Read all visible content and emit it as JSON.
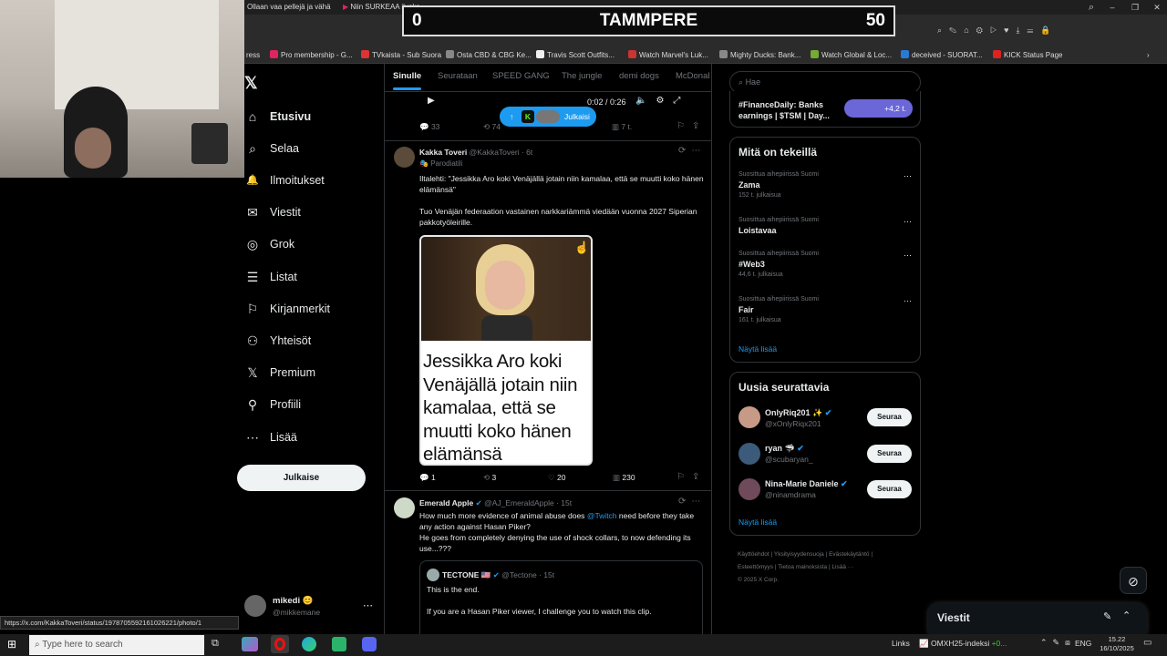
{
  "browser": {
    "tabs": [
      {
        "label": "Ollaan vaa pellejä ja vähä"
      },
      {
        "label": "Niin SURKEAA ilveks..."
      }
    ],
    "bookmarks": [
      {
        "label": "ress",
        "color": "#555555"
      },
      {
        "label": "Pro membership - G...",
        "color": "#e0245e"
      },
      {
        "label": "TVkaista - Sub Suora",
        "color": "#d33"
      },
      {
        "label": "Osta CBD & CBG Ke...",
        "color": "#888"
      },
      {
        "label": "Travis Scott Outfits...",
        "color": "#eee"
      },
      {
        "label": "Watch Marvel's Luk...",
        "color": "#c33"
      },
      {
        "label": "Mighty Ducks: Bank...",
        "color": "#888"
      },
      {
        "label": "Watch Global & Loc...",
        "color": "#7a3"
      },
      {
        "label": "deceived - SUORAT...",
        "color": "#2a7ad5"
      },
      {
        "label": "KICK Status Page",
        "color": "#d22"
      }
    ]
  },
  "overlay": {
    "left_score": "0",
    "team": "TAMMPERE",
    "right_score": "50"
  },
  "nav": {
    "items": [
      {
        "label": "Etusivu",
        "icon": "⌂",
        "name": "home"
      },
      {
        "label": "Selaa",
        "icon": "⌕",
        "name": "explore"
      },
      {
        "label": "Ilmoitukset",
        "icon": "🔔",
        "name": "notifications"
      },
      {
        "label": "Viestit",
        "icon": "✉",
        "name": "messages"
      },
      {
        "label": "Grok",
        "icon": "◎",
        "name": "grok"
      },
      {
        "label": "Listat",
        "icon": "☰",
        "name": "lists"
      },
      {
        "label": "Kirjanmerkit",
        "icon": "⚐",
        "name": "bookmarks"
      },
      {
        "label": "Yhteisöt",
        "icon": "⚇",
        "name": "communities"
      },
      {
        "label": "Premium",
        "icon": "𝕏",
        "name": "premium"
      },
      {
        "label": "Profiili",
        "icon": "⚲",
        "name": "profile"
      },
      {
        "label": "Lisää",
        "icon": "⋯",
        "name": "more"
      }
    ],
    "post_button": "Julkaise",
    "account": {
      "name": "mikedi",
      "handle": "@mikkemane"
    }
  },
  "feed": {
    "tabs": [
      {
        "label": "Sinulle"
      },
      {
        "label": "Seurataan"
      },
      {
        "label": "SPEED GANG"
      },
      {
        "label": "The jungle"
      },
      {
        "label": "demi dogs"
      },
      {
        "label": "McDonal"
      }
    ],
    "video": {
      "time": "0:02 / 0:26",
      "stats": [
        "33",
        "74",
        "7 t."
      ]
    },
    "new_posts_pill": "Julkaisi",
    "post1": {
      "name": "Kakka Toveri",
      "handle": "@KakkaToveri · 6t",
      "label": "Parodiatili",
      "text1": "Iltalehti: \"Jessikka Aro koki Venäjällä jotain niin kamalaa, että se muutti koko hänen elämänsä\"",
      "text2": "Tuo Venäjän federaation vastainen narkkariämmä viedään vuonna 2027 Siperian pakkotyöleirille.",
      "image_caption": "Jessikka Aro koki Venäjällä jotain niin kamalaa, että se muutti koko hänen elämänsä",
      "stats": {
        "replies": "1",
        "reposts": "3",
        "likes": "20",
        "views": "230"
      }
    },
    "post2": {
      "name": "Emerald Apple",
      "handle": "@AJ_EmeraldApple · 15t",
      "text_a": "How much more evidence of animal abuse does",
      "mention": "@Twitch",
      "text_b": "need before they take any action against Hasan Piker?",
      "text2": "He goes from completely denying the use of shock collars, to now defending its use...???",
      "quote": {
        "name": "TECTONE 🇺🇸",
        "handle": "@Tectone · 15t",
        "line1": "This is the end.",
        "line2": "If you are a Hasan Piker viewer, I challenge you to watch this clip."
      }
    }
  },
  "sidebar": {
    "search_placeholder": "Hae",
    "promo": {
      "line1": "#FinanceDaily: Banks",
      "line2": "earnings | $TSM | Day...",
      "count": "+4,2 t."
    },
    "trends_title": "Mitä on tekeillä",
    "trends": [
      {
        "meta": "Suosittua aihepiirissä Suomi",
        "name": "Zama",
        "count": "152 t. julkaisua"
      },
      {
        "meta": "Suosittua aihepiirissä Suomi",
        "name": "Loistavaa",
        "count": ""
      },
      {
        "meta": "Suosittua aihepiirissä Suomi",
        "name": "#Web3",
        "count": "44,6 t. julkaisua"
      },
      {
        "meta": "Suosittua aihepiirissä Suomi",
        "name": "Fair",
        "count": "161 t. julkaisua"
      }
    ],
    "show_more": "Näytä lisää",
    "follow_title": "Uusia seurattavia",
    "follow": [
      {
        "name": "OnlyRiq201 ✨",
        "handle": "@xOnlyRiqx201",
        "btn": "Seuraa"
      },
      {
        "name": "ryan 🦈",
        "handle": "@scubaryan_",
        "btn": "Seuraa"
      },
      {
        "name": "Nina-Marie Daniele",
        "handle": "@ninamdrama",
        "btn": "Seuraa"
      }
    ],
    "follow_more": "Näytä lisää",
    "footer1": "Käyttöehdot | Yksityisyydensuoja | Evästekäytäntö |",
    "footer2": "Esteettömyys | Tietoa mainoksista | Lisää ···",
    "footer3": "© 2025 X Corp.",
    "messages": "Viestit"
  },
  "status_url": "https://x.com/KakkaToveri/status/1978705592161026221/photo/1",
  "taskbar": {
    "search_placeholder": "Type here to search",
    "links": "Links",
    "stock": "OMXH25-indeksi",
    "stock_change": "+0...",
    "lang": "ENG",
    "time": "15.22",
    "date": "16/10/2025"
  }
}
